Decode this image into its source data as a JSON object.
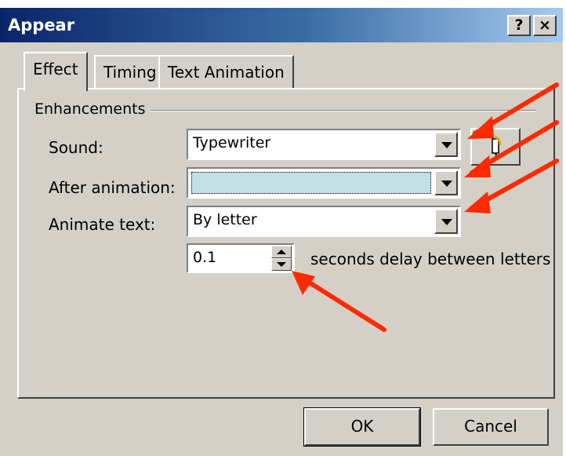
{
  "window": {
    "title": "Appear",
    "help_label": "?",
    "close_label": "×"
  },
  "tabs": [
    {
      "label": "Effect"
    },
    {
      "label": "Timing"
    },
    {
      "label": "Text Animation"
    }
  ],
  "enhancements": {
    "group_label": "Enhancements",
    "sound": {
      "label": "Sound:",
      "value": "Typewriter"
    },
    "after_animation": {
      "label": "After animation:",
      "value": ""
    },
    "animate_text": {
      "label": "Animate text:",
      "value": "By letter"
    },
    "delay": {
      "value": "0.1",
      "suffix": "seconds delay between letters"
    }
  },
  "buttons": {
    "ok": "OK",
    "cancel": "Cancel"
  },
  "colors": {
    "title_bar": "#0a246a",
    "dialog_bg": "#d4d0c8",
    "highlight_fill": "#c2e0e3",
    "annotation_arrow": "#ff2a00"
  },
  "icons": {
    "sound_button": "speaker-icon"
  }
}
